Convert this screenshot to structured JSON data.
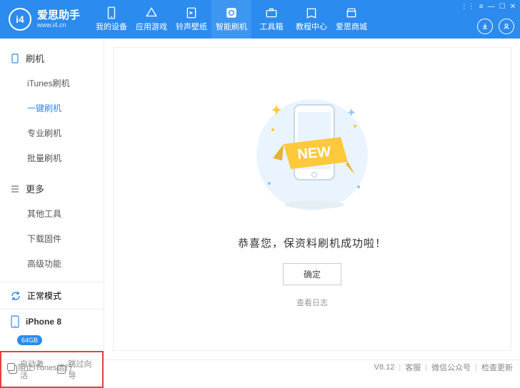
{
  "app": {
    "name": "爱思助手",
    "url": "www.i4.cn",
    "logo_letters": "i4"
  },
  "nav": [
    {
      "label": "我的设备"
    },
    {
      "label": "应用游戏"
    },
    {
      "label": "铃声壁纸"
    },
    {
      "label": "智能刷机",
      "active": true
    },
    {
      "label": "工具箱"
    },
    {
      "label": "教程中心"
    },
    {
      "label": "爱思商城"
    }
  ],
  "sidebar": {
    "groups": [
      {
        "title": "刷机",
        "items": [
          {
            "label": "iTunes刷机"
          },
          {
            "label": "一键刷机",
            "active": true
          },
          {
            "label": "专业刷机"
          },
          {
            "label": "批量刷机"
          }
        ]
      },
      {
        "title": "更多",
        "items": [
          {
            "label": "其他工具"
          },
          {
            "label": "下载固件"
          },
          {
            "label": "高级功能"
          }
        ]
      }
    ],
    "mode": "正常模式",
    "device": {
      "name": "iPhone 8",
      "storage": "64GB"
    },
    "opt_auto_activate": "自动激活",
    "opt_skip_guide": "跳过向导"
  },
  "main": {
    "banner_text": "NEW",
    "success": "恭喜您，保资料刷机成功啦！",
    "ok": "确定",
    "view_log": "查看日志"
  },
  "footer": {
    "block_itunes": "阻止iTunes运行",
    "version": "V8.12",
    "support": "客服",
    "wechat": "微信公众号",
    "update": "检查更新"
  }
}
